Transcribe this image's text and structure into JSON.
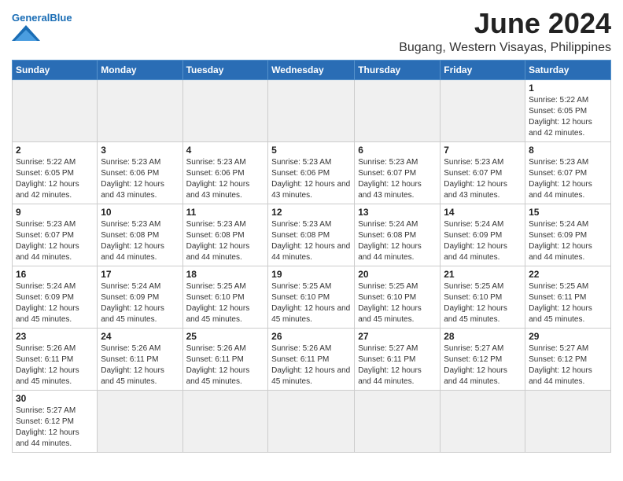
{
  "header": {
    "logo_general": "General",
    "logo_blue": "Blue",
    "month_title": "June 2024",
    "location": "Bugang, Western Visayas, Philippines"
  },
  "weekdays": [
    "Sunday",
    "Monday",
    "Tuesday",
    "Wednesday",
    "Thursday",
    "Friday",
    "Saturday"
  ],
  "weeks": [
    [
      {
        "day": "",
        "sunrise": "",
        "sunset": "",
        "daylight": "",
        "empty": true
      },
      {
        "day": "",
        "sunrise": "",
        "sunset": "",
        "daylight": "",
        "empty": true
      },
      {
        "day": "",
        "sunrise": "",
        "sunset": "",
        "daylight": "",
        "empty": true
      },
      {
        "day": "",
        "sunrise": "",
        "sunset": "",
        "daylight": "",
        "empty": true
      },
      {
        "day": "",
        "sunrise": "",
        "sunset": "",
        "daylight": "",
        "empty": true
      },
      {
        "day": "",
        "sunrise": "",
        "sunset": "",
        "daylight": "",
        "empty": true
      },
      {
        "day": "1",
        "sunrise": "Sunrise: 5:22 AM",
        "sunset": "Sunset: 6:05 PM",
        "daylight": "Daylight: 12 hours and 42 minutes.",
        "empty": false
      }
    ],
    [
      {
        "day": "2",
        "sunrise": "Sunrise: 5:22 AM",
        "sunset": "Sunset: 6:05 PM",
        "daylight": "Daylight: 12 hours and 42 minutes.",
        "empty": false
      },
      {
        "day": "3",
        "sunrise": "Sunrise: 5:23 AM",
        "sunset": "Sunset: 6:06 PM",
        "daylight": "Daylight: 12 hours and 43 minutes.",
        "empty": false
      },
      {
        "day": "4",
        "sunrise": "Sunrise: 5:23 AM",
        "sunset": "Sunset: 6:06 PM",
        "daylight": "Daylight: 12 hours and 43 minutes.",
        "empty": false
      },
      {
        "day": "5",
        "sunrise": "Sunrise: 5:23 AM",
        "sunset": "Sunset: 6:06 PM",
        "daylight": "Daylight: 12 hours and 43 minutes.",
        "empty": false
      },
      {
        "day": "6",
        "sunrise": "Sunrise: 5:23 AM",
        "sunset": "Sunset: 6:07 PM",
        "daylight": "Daylight: 12 hours and 43 minutes.",
        "empty": false
      },
      {
        "day": "7",
        "sunrise": "Sunrise: 5:23 AM",
        "sunset": "Sunset: 6:07 PM",
        "daylight": "Daylight: 12 hours and 43 minutes.",
        "empty": false
      },
      {
        "day": "8",
        "sunrise": "Sunrise: 5:23 AM",
        "sunset": "Sunset: 6:07 PM",
        "daylight": "Daylight: 12 hours and 44 minutes.",
        "empty": false
      }
    ],
    [
      {
        "day": "9",
        "sunrise": "Sunrise: 5:23 AM",
        "sunset": "Sunset: 6:07 PM",
        "daylight": "Daylight: 12 hours and 44 minutes.",
        "empty": false
      },
      {
        "day": "10",
        "sunrise": "Sunrise: 5:23 AM",
        "sunset": "Sunset: 6:08 PM",
        "daylight": "Daylight: 12 hours and 44 minutes.",
        "empty": false
      },
      {
        "day": "11",
        "sunrise": "Sunrise: 5:23 AM",
        "sunset": "Sunset: 6:08 PM",
        "daylight": "Daylight: 12 hours and 44 minutes.",
        "empty": false
      },
      {
        "day": "12",
        "sunrise": "Sunrise: 5:23 AM",
        "sunset": "Sunset: 6:08 PM",
        "daylight": "Daylight: 12 hours and 44 minutes.",
        "empty": false
      },
      {
        "day": "13",
        "sunrise": "Sunrise: 5:24 AM",
        "sunset": "Sunset: 6:08 PM",
        "daylight": "Daylight: 12 hours and 44 minutes.",
        "empty": false
      },
      {
        "day": "14",
        "sunrise": "Sunrise: 5:24 AM",
        "sunset": "Sunset: 6:09 PM",
        "daylight": "Daylight: 12 hours and 44 minutes.",
        "empty": false
      },
      {
        "day": "15",
        "sunrise": "Sunrise: 5:24 AM",
        "sunset": "Sunset: 6:09 PM",
        "daylight": "Daylight: 12 hours and 44 minutes.",
        "empty": false
      }
    ],
    [
      {
        "day": "16",
        "sunrise": "Sunrise: 5:24 AM",
        "sunset": "Sunset: 6:09 PM",
        "daylight": "Daylight: 12 hours and 45 minutes.",
        "empty": false
      },
      {
        "day": "17",
        "sunrise": "Sunrise: 5:24 AM",
        "sunset": "Sunset: 6:09 PM",
        "daylight": "Daylight: 12 hours and 45 minutes.",
        "empty": false
      },
      {
        "day": "18",
        "sunrise": "Sunrise: 5:25 AM",
        "sunset": "Sunset: 6:10 PM",
        "daylight": "Daylight: 12 hours and 45 minutes.",
        "empty": false
      },
      {
        "day": "19",
        "sunrise": "Sunrise: 5:25 AM",
        "sunset": "Sunset: 6:10 PM",
        "daylight": "Daylight: 12 hours and 45 minutes.",
        "empty": false
      },
      {
        "day": "20",
        "sunrise": "Sunrise: 5:25 AM",
        "sunset": "Sunset: 6:10 PM",
        "daylight": "Daylight: 12 hours and 45 minutes.",
        "empty": false
      },
      {
        "day": "21",
        "sunrise": "Sunrise: 5:25 AM",
        "sunset": "Sunset: 6:10 PM",
        "daylight": "Daylight: 12 hours and 45 minutes.",
        "empty": false
      },
      {
        "day": "22",
        "sunrise": "Sunrise: 5:25 AM",
        "sunset": "Sunset: 6:11 PM",
        "daylight": "Daylight: 12 hours and 45 minutes.",
        "empty": false
      }
    ],
    [
      {
        "day": "23",
        "sunrise": "Sunrise: 5:26 AM",
        "sunset": "Sunset: 6:11 PM",
        "daylight": "Daylight: 12 hours and 45 minutes.",
        "empty": false
      },
      {
        "day": "24",
        "sunrise": "Sunrise: 5:26 AM",
        "sunset": "Sunset: 6:11 PM",
        "daylight": "Daylight: 12 hours and 45 minutes.",
        "empty": false
      },
      {
        "day": "25",
        "sunrise": "Sunrise: 5:26 AM",
        "sunset": "Sunset: 6:11 PM",
        "daylight": "Daylight: 12 hours and 45 minutes.",
        "empty": false
      },
      {
        "day": "26",
        "sunrise": "Sunrise: 5:26 AM",
        "sunset": "Sunset: 6:11 PM",
        "daylight": "Daylight: 12 hours and 45 minutes.",
        "empty": false
      },
      {
        "day": "27",
        "sunrise": "Sunrise: 5:27 AM",
        "sunset": "Sunset: 6:11 PM",
        "daylight": "Daylight: 12 hours and 44 minutes.",
        "empty": false
      },
      {
        "day": "28",
        "sunrise": "Sunrise: 5:27 AM",
        "sunset": "Sunset: 6:12 PM",
        "daylight": "Daylight: 12 hours and 44 minutes.",
        "empty": false
      },
      {
        "day": "29",
        "sunrise": "Sunrise: 5:27 AM",
        "sunset": "Sunset: 6:12 PM",
        "daylight": "Daylight: 12 hours and 44 minutes.",
        "empty": false
      }
    ],
    [
      {
        "day": "30",
        "sunrise": "Sunrise: 5:27 AM",
        "sunset": "Sunset: 6:12 PM",
        "daylight": "Daylight: 12 hours and 44 minutes.",
        "empty": false
      },
      {
        "day": "",
        "sunrise": "",
        "sunset": "",
        "daylight": "",
        "empty": true
      },
      {
        "day": "",
        "sunrise": "",
        "sunset": "",
        "daylight": "",
        "empty": true
      },
      {
        "day": "",
        "sunrise": "",
        "sunset": "",
        "daylight": "",
        "empty": true
      },
      {
        "day": "",
        "sunrise": "",
        "sunset": "",
        "daylight": "",
        "empty": true
      },
      {
        "day": "",
        "sunrise": "",
        "sunset": "",
        "daylight": "",
        "empty": true
      },
      {
        "day": "",
        "sunrise": "",
        "sunset": "",
        "daylight": "",
        "empty": true
      }
    ]
  ]
}
